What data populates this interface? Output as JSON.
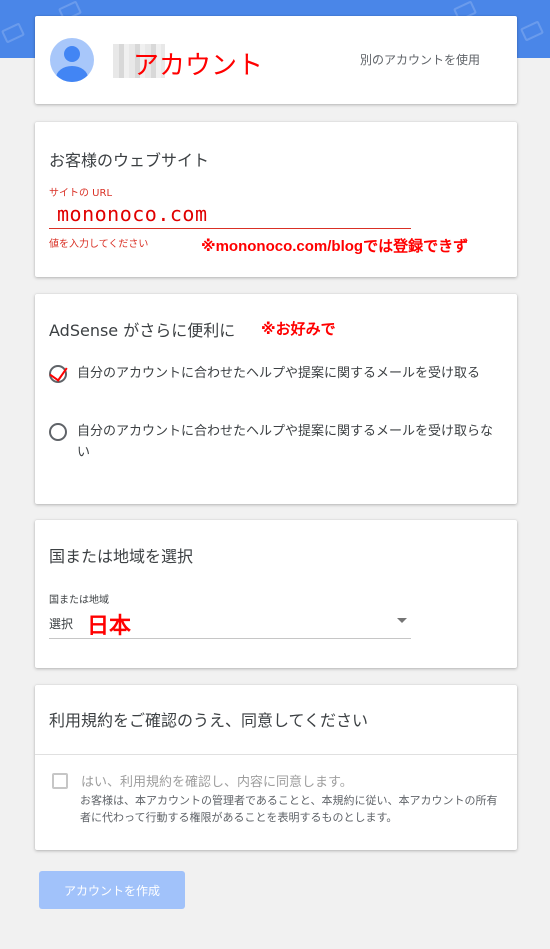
{
  "account": {
    "annotation": "アカウント",
    "use_other_label": "別のアカウントを使用"
  },
  "website": {
    "title": "お客様のウェブサイト",
    "url_label": "サイトの URL",
    "url_value": "mononoco.com",
    "error_text": "値を入力してください",
    "annotation": "※mononoco.com/blogでは登録できず"
  },
  "adsense": {
    "title": "AdSense がさらに便利に",
    "annotation": "※お好みで",
    "options": [
      {
        "label": "自分のアカウントに合わせたヘルプや提案に関するメールを受け取る"
      },
      {
        "label": "自分のアカウントに合わせたヘルプや提案に関するメールを受け取らない"
      }
    ]
  },
  "country": {
    "title": "国または地域を選択",
    "field_label": "国または地域",
    "select_value": "選択",
    "annotation": "日本"
  },
  "terms": {
    "title": "利用規約をご確認のうえ、同意してください",
    "checkbox_label": "はい、利用規約を確認し、内容に同意します。",
    "description": "お客様は、本アカウントの管理者であることと、本規約に従い、本アカウントの所有者に代わって行動する権限があることを表明するものとします。"
  },
  "buttons": {
    "create_account": "アカウントを作成"
  },
  "colors": {
    "header_blue": "#4a86e8",
    "annotation_red": "#ff0000",
    "error_red": "#d93025",
    "button_disabled": "#a1c2fa"
  }
}
